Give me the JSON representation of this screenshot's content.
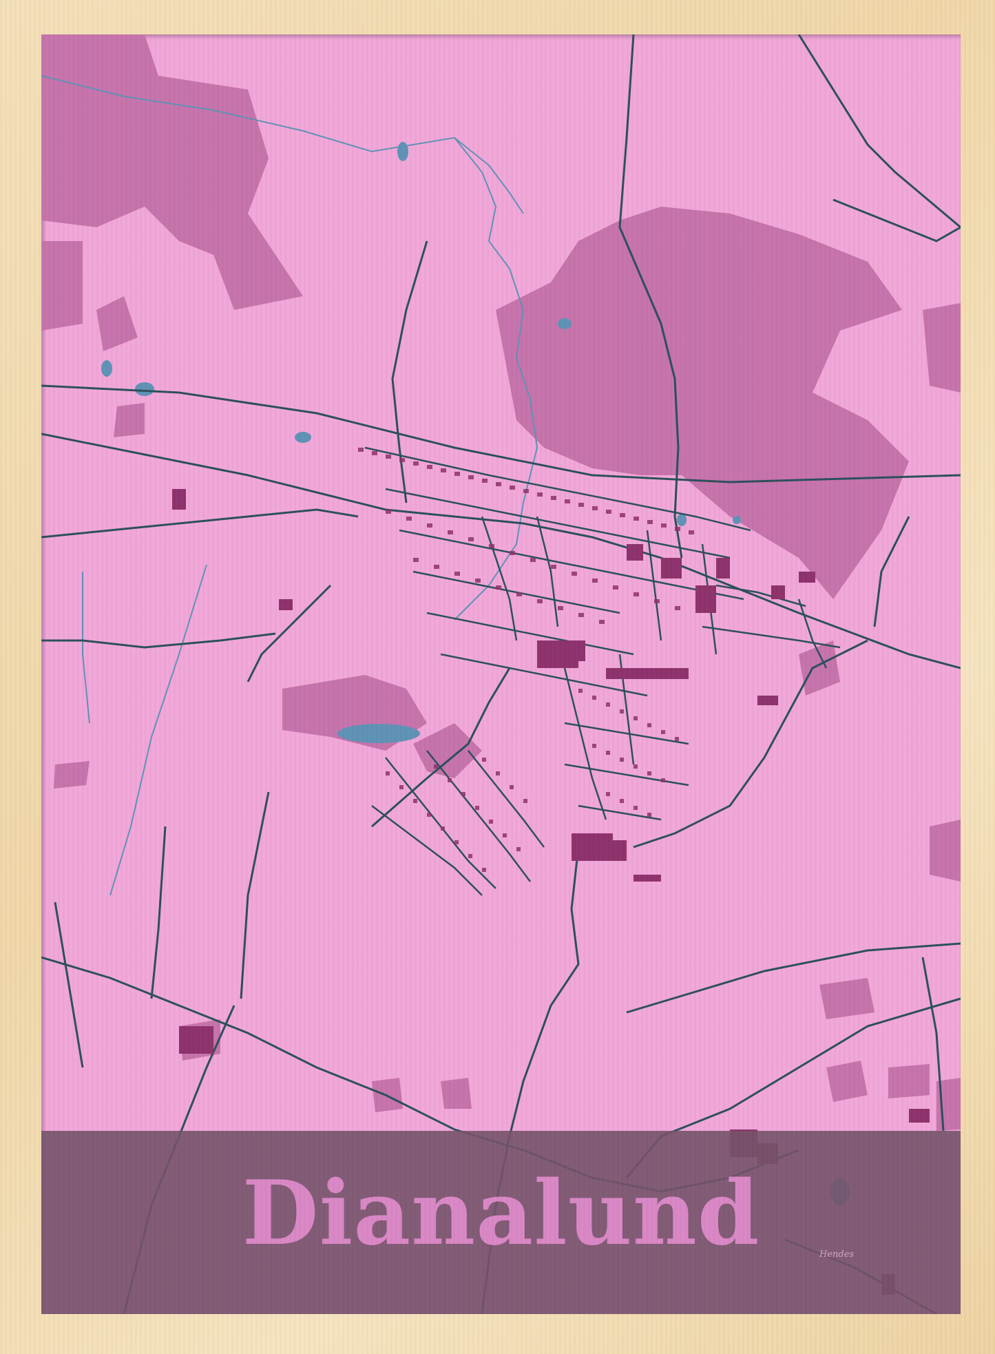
{
  "title": "Dianalund",
  "signature": "Hendes",
  "colors": {
    "frame": "#efd6a8",
    "land": "#f0a4da",
    "forest": "#c46fab",
    "roads": "#244a57",
    "buildings": "#8a2c6a",
    "water": "#5a8fb5",
    "title_band": "#704e67",
    "title_text": "#d884c6"
  }
}
